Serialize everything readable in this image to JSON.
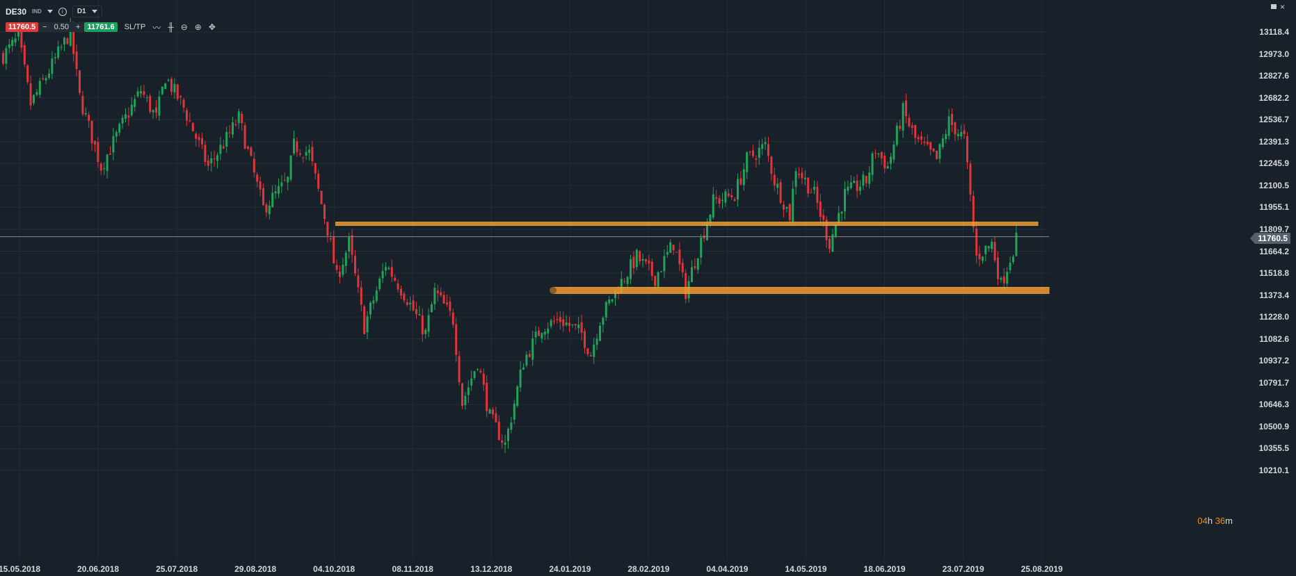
{
  "header": {
    "symbol": "DE30",
    "market": "IND",
    "timeframe": "D1",
    "sell_price": "11760.5",
    "spread": "0.50",
    "minus": "−",
    "plus": "+",
    "buy_price": "11761.6",
    "sltp": "SL/TP",
    "info": "i"
  },
  "window": {
    "minimize": "minimize",
    "close": "×"
  },
  "current_price": "11760.5",
  "countdown": {
    "hours": "04",
    "h": "h",
    "minutes": "36",
    "m": "m"
  },
  "colors": {
    "up": "#22a35a",
    "down": "#e0353b",
    "level": "#f39a2b",
    "bg": "#18212a"
  },
  "chart_data": {
    "type": "candlestick",
    "symbol": "DE30",
    "timeframe": "D1",
    "y_ticks": [
      "13118.4",
      "12973.0",
      "12827.6",
      "12682.2",
      "12536.7",
      "12391.3",
      "12245.9",
      "12100.5",
      "11955.1",
      "11809.7",
      "11664.2",
      "11518.8",
      "11373.4",
      "11228.0",
      "11082.6",
      "10937.2",
      "10791.7",
      "10646.3",
      "10500.9",
      "10355.5",
      "10210.1"
    ],
    "ylim": [
      10210.1,
      13118.4
    ],
    "x_ticks": [
      "15.05.2018",
      "20.06.2018",
      "25.07.2018",
      "29.08.2018",
      "04.10.2018",
      "08.11.2018",
      "13.12.2018",
      "24.01.2019",
      "28.02.2019",
      "04.04.2019",
      "14.05.2019",
      "18.06.2019",
      "23.07.2019",
      "25.08.2019"
    ],
    "close_path": [
      [
        0,
        12962
      ],
      [
        5,
        13077
      ],
      [
        9,
        12639
      ],
      [
        14,
        12823
      ],
      [
        22,
        13123
      ],
      [
        25,
        12685
      ],
      [
        32,
        12224
      ],
      [
        40,
        12547
      ],
      [
        45,
        12731
      ],
      [
        50,
        12547
      ],
      [
        53,
        12823
      ],
      [
        59,
        12616
      ],
      [
        67,
        12224
      ],
      [
        73,
        12409
      ],
      [
        77,
        12547
      ],
      [
        85,
        11948
      ],
      [
        93,
        12132
      ],
      [
        95,
        12363
      ],
      [
        100,
        12316
      ],
      [
        106,
        11809
      ],
      [
        109,
        11487
      ],
      [
        113,
        11717
      ],
      [
        118,
        11164
      ],
      [
        125,
        11579
      ],
      [
        132,
        11349
      ],
      [
        138,
        11118
      ],
      [
        141,
        11395
      ],
      [
        147,
        11210
      ],
      [
        150,
        10657
      ],
      [
        155,
        10934
      ],
      [
        159,
        10565
      ],
      [
        164,
        10381
      ],
      [
        170,
        10934
      ],
      [
        176,
        11164
      ],
      [
        182,
        11210
      ],
      [
        189,
        11118
      ],
      [
        192,
        10980
      ],
      [
        195,
        11210
      ],
      [
        200,
        11395
      ],
      [
        207,
        11625
      ],
      [
        213,
        11487
      ],
      [
        219,
        11717
      ],
      [
        223,
        11395
      ],
      [
        227,
        11671
      ],
      [
        232,
        11994
      ],
      [
        239,
        12040
      ],
      [
        243,
        12270
      ],
      [
        249,
        12363
      ],
      [
        252,
        12132
      ],
      [
        257,
        11901
      ],
      [
        259,
        12224
      ],
      [
        265,
        12040
      ],
      [
        270,
        11717
      ],
      [
        275,
        12040
      ],
      [
        282,
        12132
      ],
      [
        285,
        12339
      ],
      [
        289,
        12224
      ],
      [
        294,
        12593
      ],
      [
        298,
        12409
      ],
      [
        305,
        12270
      ],
      [
        309,
        12524
      ],
      [
        314,
        12409
      ],
      [
        318,
        11625
      ],
      [
        323,
        11717
      ],
      [
        326,
        11441
      ],
      [
        331,
        11740
      ]
    ],
    "levels": [
      {
        "price": 11846,
        "from_bar": 109
      },
      {
        "price": 11404,
        "from_bar": 180
      }
    ],
    "current": 11760.5
  }
}
